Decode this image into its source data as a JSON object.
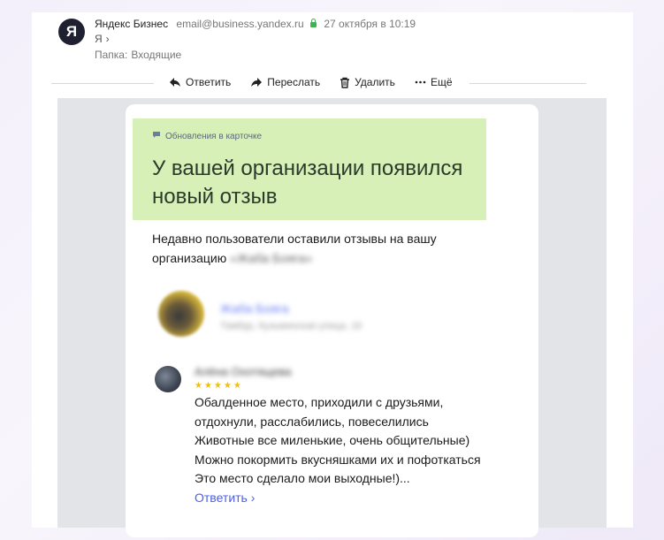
{
  "header": {
    "avatar_letter": "Я",
    "sender": "Яндекс Бизнес",
    "email": "email@business.yandex.ru",
    "date": "27 октября в 10:19",
    "recipient": "Я",
    "recipient_chevron": "›",
    "folder_label": "Папка:",
    "folder_value": "Входящие"
  },
  "toolbar": {
    "reply": "Ответить",
    "forward": "Переслать",
    "delete": "Удалить",
    "more": "Ещё"
  },
  "message": {
    "banner_tag": "Обновления в карточке",
    "banner_title": "У вашей организации появился новый отзыв",
    "intro": "Недавно пользователи оставили отзывы на вашу организацию",
    "org_name_blurred": "Жаба Бояга",
    "intro_org_blurred": "«Жаба Бояга»",
    "org_address_blurred": "Тамбур, Кузьминская улица, 16",
    "reviewer_name_blurred": "Алёна Охотящева",
    "rating_stars": "★★★★★",
    "rating": 5,
    "review_text": "Обалденное место, приходили с друзьями,\nотдохнули, расслабились, повеселились\nЖивотные все миленькие, очень общительные)\nМожно покормить вкусняшками их и пофоткаться\nЭто место сделало мои выходные!)...",
    "reply_link": "Ответить ›"
  },
  "colors": {
    "banner_bg": "#d6f0b8",
    "link": "#4a5fe8",
    "star": "#f2c200",
    "page_gray": "#e3e4e8"
  }
}
